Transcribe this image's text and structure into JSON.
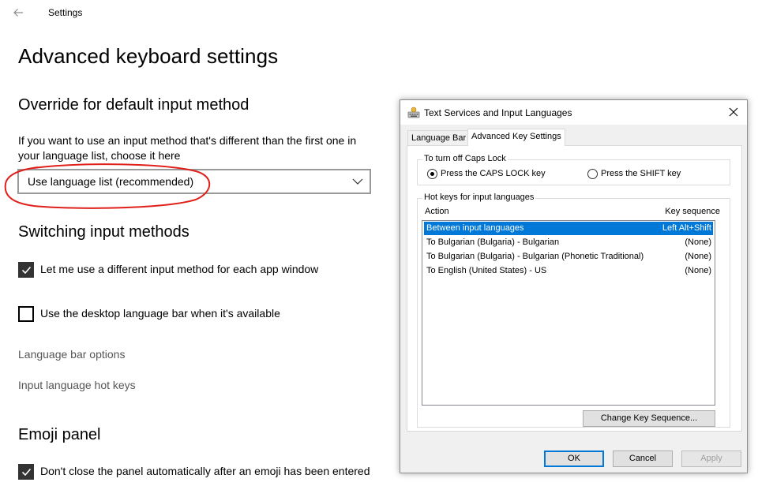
{
  "window": {
    "app_title": "Settings"
  },
  "page": {
    "title": "Advanced keyboard settings"
  },
  "override": {
    "title": "Override for default input method",
    "description": "If you want to use an input method that's different than the first one in your language list, choose it here",
    "selected_value": "Use language list (recommended)"
  },
  "switching": {
    "title": "Switching input methods",
    "checkbox_app_window": {
      "label": "Let me use a different input method for each app window",
      "checked": true
    },
    "checkbox_language_bar": {
      "label": "Use the desktop language bar when it's available",
      "checked": false
    },
    "link_language_bar_options": "Language bar options",
    "link_hot_keys": "Input language hot keys"
  },
  "emoji": {
    "title": "Emoji panel",
    "checkbox_keep_open": {
      "label": "Don't close the panel automatically after an emoji has been entered",
      "checked": true
    }
  },
  "annotation": {
    "color": "#e0201b"
  },
  "dialog": {
    "title": "Text Services and Input Languages",
    "tabs": [
      {
        "label": "Language Bar",
        "active": false
      },
      {
        "label": "Advanced Key Settings",
        "active": true
      }
    ],
    "caps_lock": {
      "group_label": "To turn off Caps Lock",
      "options": [
        {
          "label": "Press the CAPS LOCK key",
          "checked": true
        },
        {
          "label": "Press the SHIFT key",
          "checked": false
        }
      ]
    },
    "hotkeys": {
      "group_label": "Hot keys for input languages",
      "col_action": "Action",
      "col_sequence": "Key sequence",
      "rows": [
        {
          "action": "Between input languages",
          "sequence": "Left Alt+Shift",
          "selected": true
        },
        {
          "action": "To Bulgarian (Bulgaria) - Bulgarian",
          "sequence": "(None)",
          "selected": false
        },
        {
          "action": "To Bulgarian (Bulgaria) - Bulgarian (Phonetic Traditional)",
          "sequence": "(None)",
          "selected": false
        },
        {
          "action": "To English (United States) - US",
          "sequence": "(None)",
          "selected": false
        }
      ],
      "change_button": "Change Key Sequence..."
    },
    "buttons": {
      "ok": "OK",
      "cancel": "Cancel",
      "apply": "Apply"
    },
    "selection_color": "#0078d7"
  }
}
